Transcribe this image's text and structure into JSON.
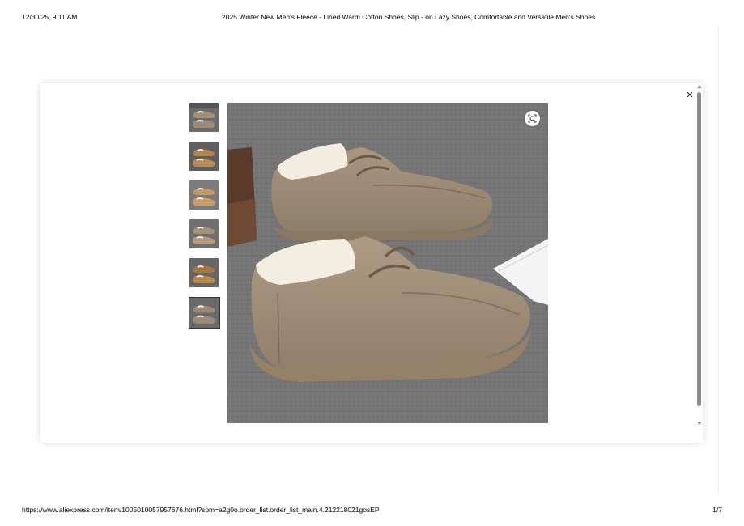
{
  "print": {
    "date": "12/30/25, 9:11 AM",
    "title": "2025 Winter New Men's Fleece - Lined Warm Cotton Shoes, Slip - on Lazy Shoes, Comfortable and Versatile Men's Shoes",
    "url": "https://www.aliexpress.com/item/1005010057957676.html?spm=a2g0o.order_list.order_list_main.4.212218021gosEP",
    "page": "1/7"
  },
  "viewer": {
    "close_label": "×",
    "thumbnails": [
      {
        "color": "khaki-brown",
        "selected": false
      },
      {
        "color": "tan",
        "selected": false
      },
      {
        "color": "light-tan",
        "selected": false
      },
      {
        "color": "beige",
        "selected": false
      },
      {
        "color": "camel",
        "selected": false
      },
      {
        "color": "khaki",
        "selected": true
      }
    ],
    "zoom_icon": "magnify-scan-icon"
  },
  "colors": {
    "shoe_khaki": "#9c8b74",
    "fleece": "#f2ece0",
    "carpet": "#767676"
  }
}
